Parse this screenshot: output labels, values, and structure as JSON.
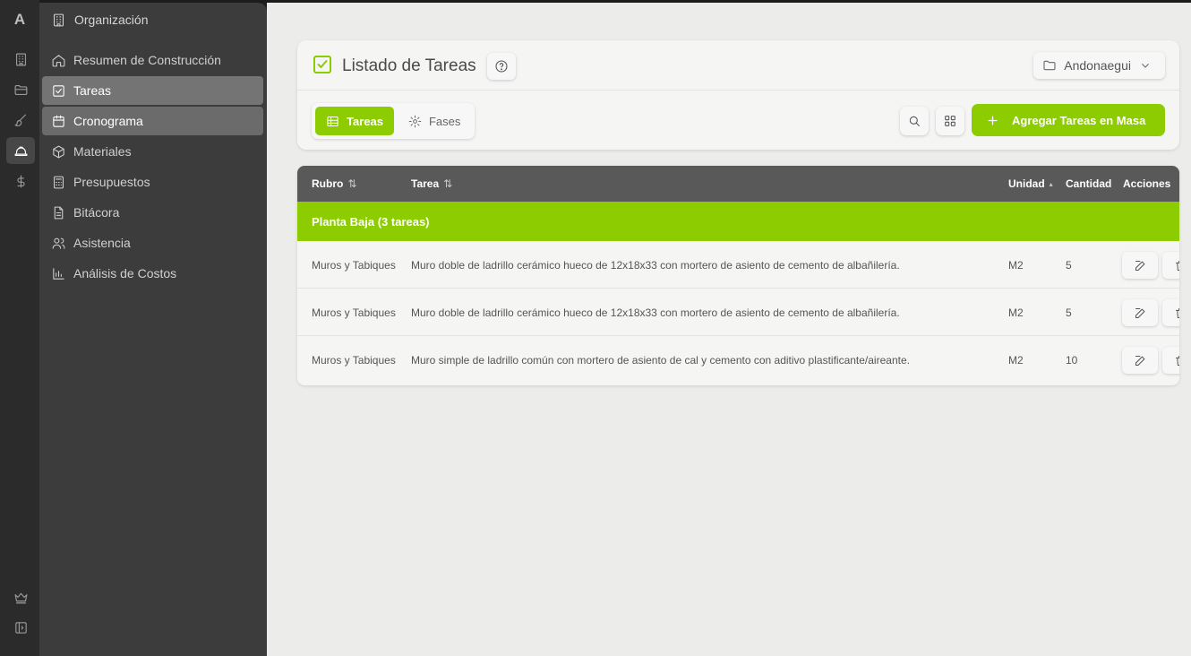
{
  "rail": {
    "logo": "A",
    "icons": [
      "building-icon",
      "folder-icon",
      "brush-icon",
      "helmet-icon",
      "dollar-icon",
      "crown-icon",
      "panel-toggle-icon"
    ]
  },
  "sidebar": {
    "org_label": "Organización",
    "items": [
      {
        "label": "Resumen de Construcción",
        "icon": "home-icon"
      },
      {
        "label": "Tareas",
        "icon": "checkbox-icon"
      },
      {
        "label": "Cronograma",
        "icon": "calendar-icon"
      },
      {
        "label": "Materiales",
        "icon": "package-icon"
      },
      {
        "label": "Presupuestos",
        "icon": "calculator-icon"
      },
      {
        "label": "Bitácora",
        "icon": "document-icon"
      },
      {
        "label": "Asistencia",
        "icon": "users-icon"
      },
      {
        "label": "Análisis de Costos",
        "icon": "bar-chart-icon"
      }
    ]
  },
  "header": {
    "title": "Listado de Tareas",
    "project": "Andonaegui"
  },
  "tabs": [
    {
      "label": "Tareas",
      "active": true
    },
    {
      "label": "Fases",
      "active": false
    }
  ],
  "toolbar": {
    "add_label": "Agregar Tareas en Masa"
  },
  "table": {
    "columns": {
      "rubro": "Rubro",
      "tarea": "Tarea",
      "unidad": "Unidad",
      "cantidad": "Cantidad",
      "acciones": "Acciones"
    },
    "group_label": "Planta Baja (3 tareas)",
    "rows": [
      {
        "rubro": "Muros y Tabiques",
        "tarea": "Muro doble de ladrillo cerámico hueco de 12x18x33 con mortero de asiento de cemento de albañilería.",
        "unidad": "M2",
        "cantidad": "5"
      },
      {
        "rubro": "Muros y Tabiques",
        "tarea": "Muro doble de ladrillo cerámico hueco de 12x18x33 con mortero de asiento de cemento de albañilería.",
        "unidad": "M2",
        "cantidad": "5"
      },
      {
        "rubro": "Muros y Tabiques",
        "tarea": "Muro simple de ladrillo común con mortero de asiento de cal y cemento con aditivo plastificante/aireante.",
        "unidad": "M2",
        "cantidad": "10"
      }
    ]
  },
  "colors": {
    "accent": "#8ccc00",
    "sidebar": "#3c3c3c",
    "rail": "#2b2b2b",
    "table_header": "#595959",
    "background": "#ececea"
  }
}
